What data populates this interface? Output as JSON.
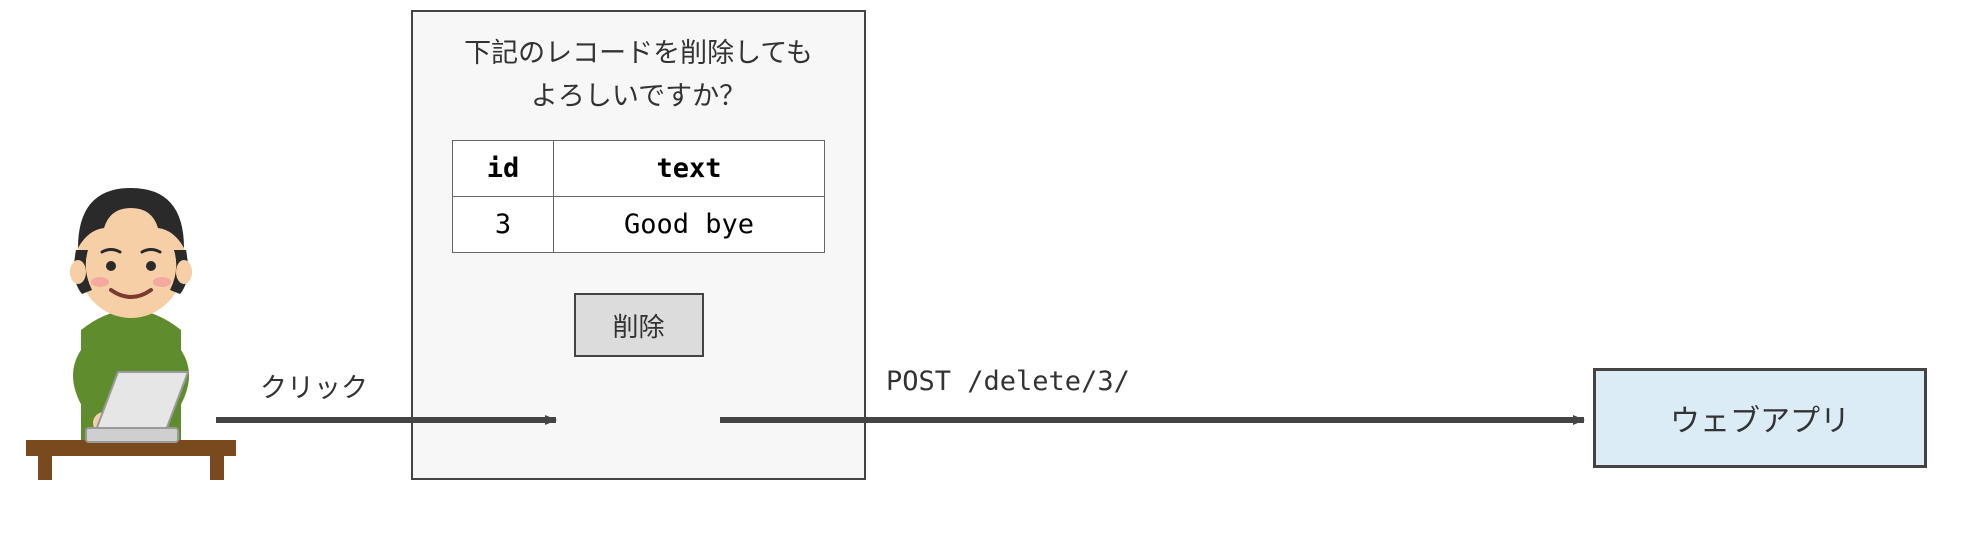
{
  "dialog": {
    "title_line1": "下記のレコードを削除しても",
    "title_line2": "よろしいですか？",
    "columns": {
      "id": "id",
      "text": "text"
    },
    "row": {
      "id": "3",
      "text": "Good bye"
    },
    "delete_label": "削除"
  },
  "arrows": {
    "click_label": "クリック",
    "request_label": "POST /delete/3/"
  },
  "webapp": {
    "label": "ウェブアプリ"
  }
}
